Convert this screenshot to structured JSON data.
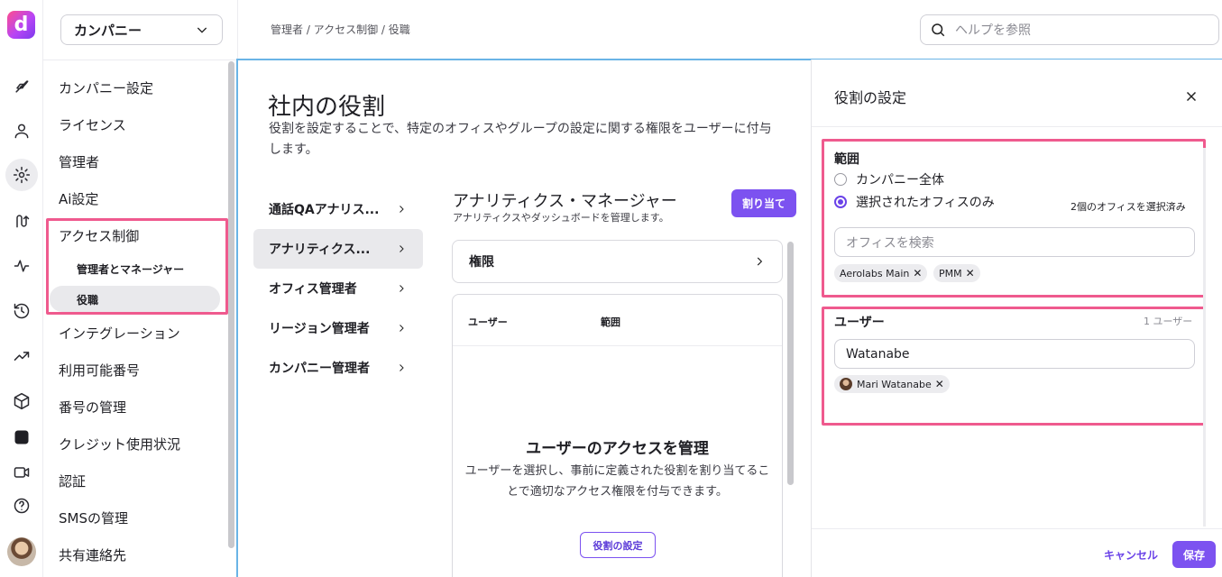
{
  "app": {
    "logo_letter": "d"
  },
  "rail": {
    "icons": [
      "rocket-icon",
      "user-icon",
      "gear-icon",
      "routing-icon",
      "activity-icon",
      "history-icon",
      "trending-icon",
      "cube-icon",
      "dialpad-ai-icon",
      "video-icon",
      "help-icon"
    ]
  },
  "sidebar": {
    "company_select": "カンパニー",
    "items": [
      {
        "label": "カンパニー設定"
      },
      {
        "label": "ライセンス"
      },
      {
        "label": "管理者"
      },
      {
        "label": "Ai設定"
      },
      {
        "label": "アクセス制御"
      },
      {
        "label": "インテグレーション"
      },
      {
        "label": "利用可能番号"
      },
      {
        "label": "番号の管理"
      },
      {
        "label": "クレジット使用状況"
      },
      {
        "label": "認証"
      },
      {
        "label": "SMSの管理"
      },
      {
        "label": "共有連絡先"
      }
    ],
    "subitems": [
      {
        "label": "管理者とマネージャー"
      },
      {
        "label": "役職"
      }
    ]
  },
  "topbar": {
    "breadcrumb": "管理者 / アクセス制御 / 役職",
    "help_placeholder": "ヘルプを参照"
  },
  "main": {
    "title": "社内の役割",
    "description": "役割を設定することで、特定のオフィスやグループの設定に関する権限をユーザーに付与します。",
    "roles": [
      {
        "label": "通話QAアナリス..."
      },
      {
        "label": "アナリティクス..."
      },
      {
        "label": "オフィス管理者"
      },
      {
        "label": "リージョン管理者"
      },
      {
        "label": "カンパニー管理者"
      }
    ],
    "detail": {
      "title": "アナリティクス・マネージャー",
      "subtitle": "アナリティクスやダッシュボードを管理します。",
      "assign_button": "割り当て",
      "permissions_label": "権限",
      "col_user": "ユーザー",
      "col_scope": "範囲",
      "empty_title": "ユーザーのアクセスを管理",
      "empty_desc": "ユーザーを選択し、事前に定義された役割を割り当てることで適切なアクセス権限を付与できます。",
      "role_setting_button": "役割の設定"
    }
  },
  "panel": {
    "title": "役割の設定",
    "scope": {
      "label": "範囲",
      "option_all": "カンパニー全体",
      "option_selected": "選択されたオフィスのみ",
      "selected_option": "option_selected",
      "office_count": "2個のオフィスを選択済み",
      "search_placeholder": "オフィスを検索",
      "chips": [
        "Aerolabs Main",
        "PMM"
      ]
    },
    "users": {
      "label": "ユーザー",
      "count": "1 ユーザー",
      "input_value": "Watanabe",
      "chips": [
        "Mari Watanabe"
      ]
    },
    "cancel": "キャンセル",
    "save": "保存"
  },
  "colors": {
    "accent": "#7c52f0",
    "highlight": "#ef5a8e",
    "focus_line": "#6ab4e6"
  }
}
